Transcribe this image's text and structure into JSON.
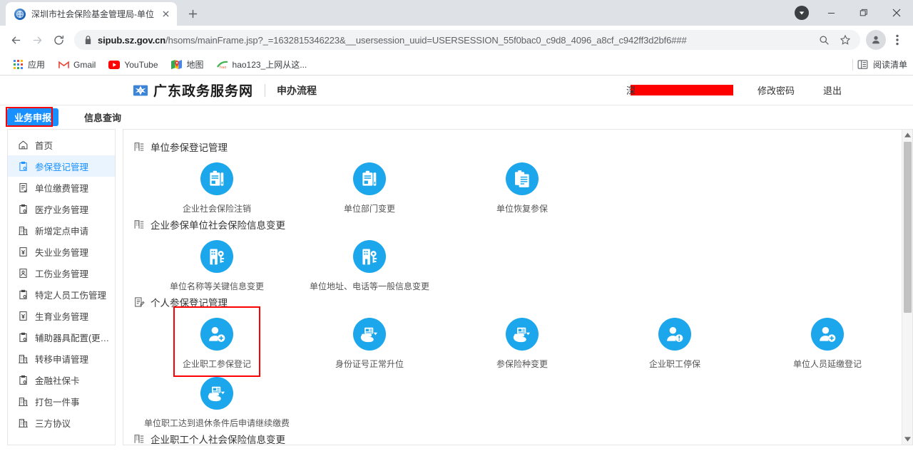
{
  "browser": {
    "tab": {
      "title": "深圳市社会保险基金管理局-单位",
      "favicon": "globe-icon",
      "close_label": "✕"
    },
    "new_tab_label": "+",
    "window_controls": {
      "minimize": "—",
      "maximize": "❐",
      "close": "✕"
    },
    "download_icon": "download-icon",
    "nav": {
      "back": "←",
      "forward": "→",
      "reload": "⟳"
    },
    "omnibox": {
      "lock_icon": "lock-icon",
      "url_host": "sipub.sz.gov.cn",
      "url_path": "/hsoms/mainFrame.jsp?_=1632815346223&__usersession_uuid=USERSESSION_55f0bac0_c9d8_4096_a8cf_c942ff3d2bf6###",
      "zoom_icon": "search-icon",
      "bookmark_icon": "star-icon"
    },
    "profile_icon": "person-icon",
    "menu_icon": "kebab-menu-icon",
    "bookmarks": [
      {
        "label": "应用",
        "icon": "apps-grid-icon"
      },
      {
        "label": "Gmail",
        "icon": "gmail-icon"
      },
      {
        "label": "YouTube",
        "icon": "youtube-icon"
      },
      {
        "label": "地图",
        "icon": "maps-icon"
      },
      {
        "label": "hao123_上网从这...",
        "icon": "hao123-icon"
      }
    ],
    "reading_list": {
      "label": "阅读清单",
      "icon": "reading-list-icon"
    }
  },
  "site": {
    "logo_text": "广东政务服务网",
    "logo_icon": "guangdong-logo-icon",
    "sub_title": "申办流程",
    "user_redacted": "深",
    "links": [
      {
        "label": "修改密码"
      },
      {
        "label": "退出"
      }
    ]
  },
  "top_tabs": [
    {
      "label": "业务申报",
      "active": true
    },
    {
      "label": "信息查询",
      "active": false
    }
  ],
  "sidebar": {
    "items": [
      {
        "label": "首页",
        "icon": "home-icon",
        "active": false
      },
      {
        "label": "参保登记管理",
        "icon": "clipboard-gear-icon",
        "active": true
      },
      {
        "label": "单位缴费管理",
        "icon": "document-check-icon",
        "active": false
      },
      {
        "label": "医疗业务管理",
        "icon": "clipboard-gear-icon",
        "active": false
      },
      {
        "label": "新增定点申请",
        "icon": "building-icon",
        "active": false
      },
      {
        "label": "失业业务管理",
        "icon": "document-yen-icon",
        "active": false
      },
      {
        "label": "工伤业务管理",
        "icon": "document-person-icon",
        "active": false
      },
      {
        "label": "特定人员工伤管理",
        "icon": "clipboard-gear-icon",
        "active": false
      },
      {
        "label": "生育业务管理",
        "icon": "document-yen-icon",
        "active": false
      },
      {
        "label": "辅助器具配置(更换...",
        "icon": "clipboard-gear-icon",
        "active": false
      },
      {
        "label": "转移申请管理",
        "icon": "building-icon",
        "active": false
      },
      {
        "label": "金融社保卡",
        "icon": "clipboard-gear-icon",
        "active": false
      },
      {
        "label": "打包一件事",
        "icon": "building-icon",
        "active": false
      },
      {
        "label": "三方协议",
        "icon": "building-icon",
        "active": false
      }
    ]
  },
  "main": {
    "groups": [
      {
        "title": "单位参保登记管理",
        "icon": "building-list-icon",
        "tiles": [
          {
            "label": "企业社会保险注销",
            "icon": "clipboard-doc-icon",
            "highlighted": false
          },
          {
            "label": "单位部门变更",
            "icon": "clipboard-doc-icon",
            "highlighted": false
          },
          {
            "label": "单位恢复参保",
            "icon": "clipboard-lines-icon",
            "highlighted": false
          }
        ]
      },
      {
        "title": "企业参保单位社会保险信息变更",
        "icon": "building-list-icon",
        "tiles": [
          {
            "label": "单位名称等关键信息变更",
            "icon": "building-key-icon",
            "highlighted": false
          },
          {
            "label": "单位地址、电话等一般信息变更",
            "icon": "building-key-icon",
            "highlighted": false
          }
        ]
      },
      {
        "title": "个人参保登记管理",
        "icon": "document-edit-icon",
        "tiles": [
          {
            "label": "企业职工参保登记",
            "icon": "person-add-icon",
            "highlighted": true
          },
          {
            "label": "身份证号正常升位",
            "icon": "hand-card-icon",
            "highlighted": false
          },
          {
            "label": "参保险种变更",
            "icon": "hand-card-icon",
            "highlighted": false
          },
          {
            "label": "企业职工停保",
            "icon": "person-minus-icon",
            "highlighted": false
          },
          {
            "label": "单位人员延缴登记",
            "icon": "person-add-icon",
            "highlighted": false
          }
        ]
      },
      {
        "title": "",
        "icon": "",
        "tiles": [
          {
            "label": "单位职工达到退休条件后申请继续缴费",
            "icon": "hand-card-icon",
            "highlighted": false
          }
        ]
      },
      {
        "title": "企业职工个人社会保险信息变更",
        "icon": "building-list-icon",
        "tiles": []
      }
    ]
  },
  "scrollbar": {
    "up_arrow": "▲",
    "down_arrow": "▼"
  },
  "colors": {
    "accent": "#1890ff",
    "tile_blue": "#1ca7ec",
    "highlight_red": "#ff0000",
    "active_nav_bg": "#eaf4fe"
  }
}
